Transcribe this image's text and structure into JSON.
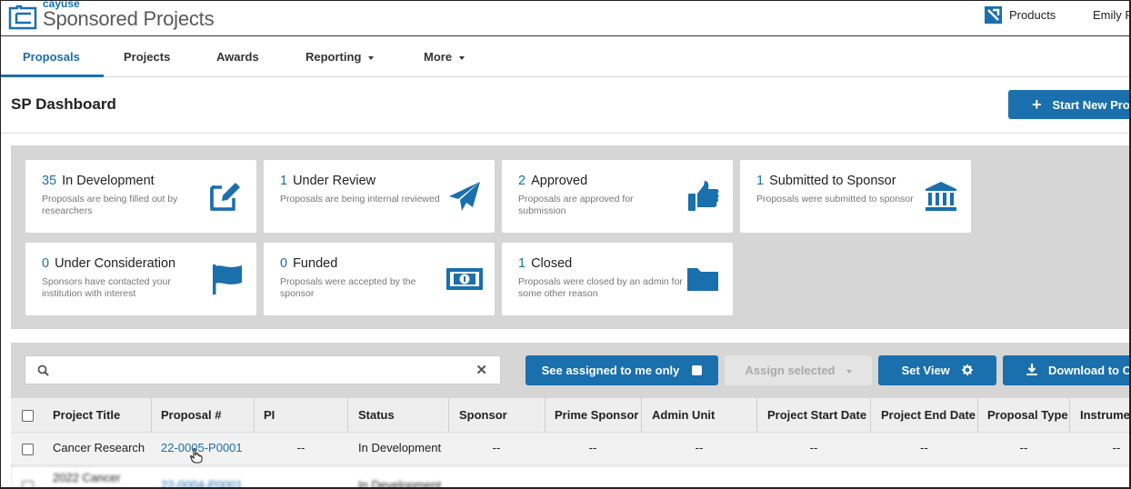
{
  "app": {
    "logo_small": "cayuse",
    "logo_big": "Sponsored Projects",
    "products_label": "Products",
    "user_name": "Emily R"
  },
  "nav": {
    "items": [
      {
        "label": "Proposals",
        "active": true
      },
      {
        "label": "Projects"
      },
      {
        "label": "Awards"
      },
      {
        "label": "Reporting"
      },
      {
        "label": "More"
      }
    ]
  },
  "page": {
    "title": "SP Dashboard",
    "start_button": "Start New Proposal"
  },
  "status_cards": [
    {
      "count": "35",
      "label": "In Development",
      "desc": "Proposals are being filled out by researchers",
      "icon": "edit-icon"
    },
    {
      "count": "1",
      "label": "Under Review",
      "desc": "Proposals are being internal reviewed",
      "icon": "paper-plane-icon"
    },
    {
      "count": "2",
      "label": "Approved",
      "desc": "Proposals are approved for submission",
      "icon": "thumbs-up-icon"
    },
    {
      "count": "1",
      "label": "Submitted to Sponsor",
      "desc": "Proposals were submitted to sponsor",
      "icon": "bank-icon"
    },
    {
      "count": "0",
      "label": "Under Consideration",
      "desc": "Sponsors have contacted your institution with interest",
      "icon": "flag-icon"
    },
    {
      "count": "0",
      "label": "Funded",
      "desc": "Proposals were accepted by the sponsor",
      "icon": "money-bill-icon"
    },
    {
      "count": "1",
      "label": "Closed",
      "desc": "Proposals were closed by an admin for some other reason",
      "icon": "folder-icon"
    }
  ],
  "toolbar": {
    "search_placeholder": "",
    "assigned_label": "See assigned to me only",
    "assign_selected_label": "Assign selected",
    "set_view_label": "Set View",
    "download_label": "Download to CSV"
  },
  "table": {
    "columns": [
      "Project Title",
      "Proposal #",
      "PI",
      "Status",
      "Sponsor",
      "Prime Sponsor",
      "Admin Unit",
      "Project Start Date",
      "Project End Date",
      "Proposal Type",
      "Instrument"
    ],
    "rows": [
      [
        "Cancer Research",
        "22-0005-P0001",
        "--",
        "In Development",
        "--",
        "--",
        "--",
        "--",
        "--",
        "--",
        "--"
      ],
      [
        "2022 Cancer",
        "22-0004-P0001",
        "--",
        "In Development",
        "--",
        "--",
        "--",
        "--",
        "--",
        "--",
        "--"
      ]
    ]
  },
  "colors": {
    "accent": "#1a6fad",
    "panel_bg": "#d6d6d6"
  }
}
